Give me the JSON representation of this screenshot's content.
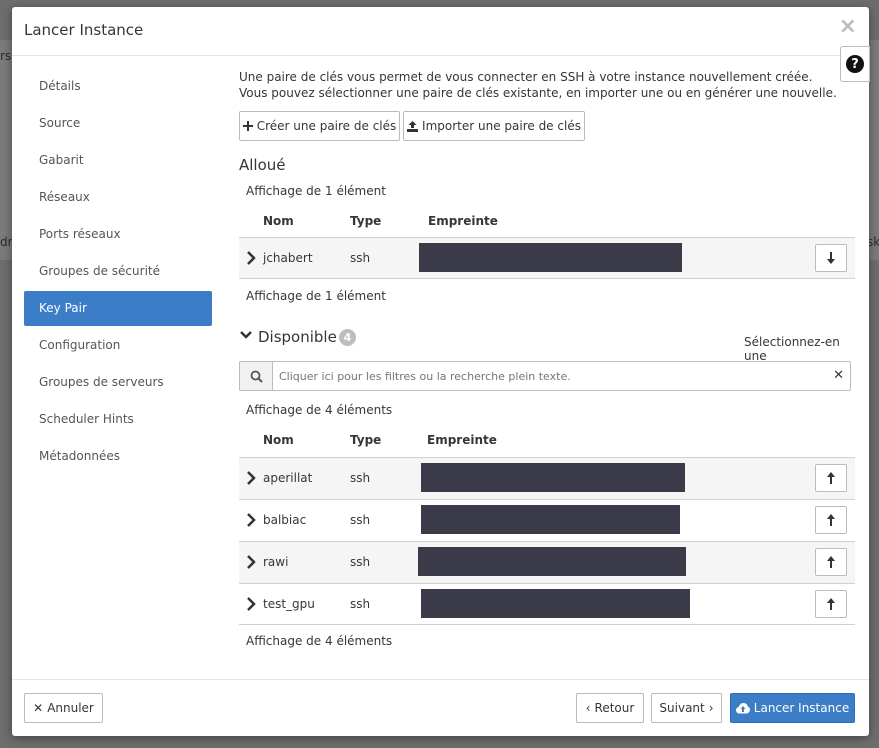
{
  "background": {
    "fragments": [
      "rs",
      "dr",
      "sk"
    ]
  },
  "modal": {
    "title": "Lancer Instance",
    "close_glyph": "×",
    "help_glyph": "?"
  },
  "nav": {
    "items": [
      {
        "label": "Détails"
      },
      {
        "label": "Source"
      },
      {
        "label": "Gabarit"
      },
      {
        "label": "Réseaux"
      },
      {
        "label": "Ports réseaux"
      },
      {
        "label": "Groupes de sécurité"
      },
      {
        "label": "Key Pair"
      },
      {
        "label": "Configuration"
      },
      {
        "label": "Groupes de serveurs"
      },
      {
        "label": "Scheduler Hints"
      },
      {
        "label": "Métadonnées"
      }
    ],
    "active": "Key Pair"
  },
  "content": {
    "intro": "Une paire de clés vous permet de vous connecter en SSH à votre instance nouvellement créée. Vous pouvez sélectionner une paire de clés existante, en importer une ou en générer une nouvelle.",
    "create_button": "Créer une paire de clés",
    "import_button": "Importer une paire de clés",
    "allocated": {
      "title": "Alloué",
      "count_text": "Affichage de 1 élément",
      "columns": [
        "Nom",
        "Type",
        "Empreinte"
      ],
      "rows": [
        {
          "name": "jchabert",
          "type": "ssh"
        }
      ]
    },
    "available": {
      "title": "Disponible",
      "badge": "4",
      "select_hint": "Sélectionnez-en une",
      "search_placeholder": "Cliquer ici pour les filtres ou la recherche plein texte.",
      "count_text": "Affichage de 4 éléments",
      "columns": [
        "Nom",
        "Type",
        "Empreinte"
      ],
      "rows": [
        {
          "name": "aperillat",
          "type": "ssh"
        },
        {
          "name": "balbiac",
          "type": "ssh"
        },
        {
          "name": "rawi",
          "type": "ssh"
        },
        {
          "name": "test_gpu",
          "type": "ssh"
        }
      ]
    }
  },
  "footer": {
    "cancel": "Annuler",
    "back": "Retour",
    "next": "Suivant",
    "launch": "Lancer Instance"
  },
  "colors": {
    "primary": "#3b7dc7",
    "redaction": "#3a3a48"
  }
}
